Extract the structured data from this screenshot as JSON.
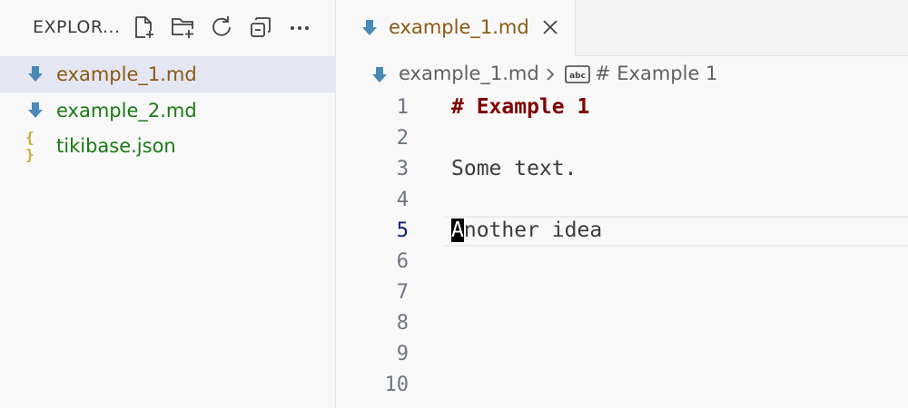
{
  "sidebar": {
    "title": "EXPLOR...",
    "actions": [
      {
        "name": "new-file-icon"
      },
      {
        "name": "new-folder-icon"
      },
      {
        "name": "refresh-icon"
      },
      {
        "name": "collapse-all-icon"
      },
      {
        "name": "more-actions-icon"
      }
    ],
    "files": [
      {
        "label": "example_1.md",
        "icon": "markdown-icon",
        "color": "#8a5a12",
        "selected": true
      },
      {
        "label": "example_2.md",
        "icon": "markdown-icon",
        "color": "#1a7a14",
        "selected": false
      },
      {
        "label": "tikibase.json",
        "icon": "json-icon",
        "icon_text": "{ }",
        "color": "#1a7a14",
        "selected": false
      }
    ]
  },
  "tab": {
    "label": "example_1.md",
    "close": "×"
  },
  "breadcrumb": {
    "file": "example_1.md",
    "symbol": "# Example 1",
    "symbol_icon_text": "abc"
  },
  "editor": {
    "line_numbers": [
      "1",
      "2",
      "3",
      "4",
      "5",
      "6",
      "7",
      "8",
      "9",
      "10"
    ],
    "active_line": "5",
    "lines": {
      "l1": "# Example 1",
      "l3": "Some text.",
      "l5_cursor_char": "A",
      "l5_rest": "nother idea"
    }
  },
  "colors": {
    "markdown_icon": "#4a88b5",
    "heading": "#800000",
    "selected_file": "#8a5a12",
    "file_green": "#1a7a14"
  }
}
